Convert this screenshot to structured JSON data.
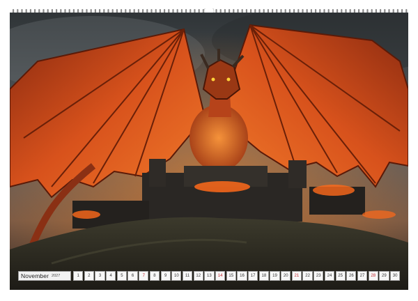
{
  "calendar": {
    "month": "November",
    "year": "2027",
    "days": [
      "1",
      "2",
      "3",
      "4",
      "5",
      "6",
      "7",
      "8",
      "9",
      "10",
      "11",
      "12",
      "13",
      "14",
      "15",
      "16",
      "17",
      "18",
      "19",
      "20",
      "21",
      "22",
      "23",
      "24",
      "25",
      "26",
      "27",
      "28",
      "29",
      "30"
    ],
    "sunday_days": [
      "7",
      "14",
      "21",
      "28"
    ]
  },
  "colors": {
    "sunday": "#c0242b",
    "fire": "#ff6a1a",
    "wing": "#c9461a",
    "sky": "#4a5056"
  }
}
